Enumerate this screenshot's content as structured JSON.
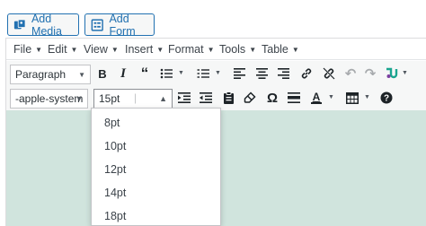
{
  "media_buttons": {
    "add_media": "Add Media",
    "add_form": "Add Form"
  },
  "menubar": {
    "items": [
      "File",
      "Edit",
      "View",
      "Insert",
      "Format",
      "Tools",
      "Table"
    ]
  },
  "toolbar1": {
    "format_select": "Paragraph"
  },
  "toolbar2": {
    "font_family_select": "-apple-system",
    "font_size_select": "15pt"
  },
  "font_size_dropdown": {
    "options": [
      "8pt",
      "10pt",
      "12pt",
      "14pt",
      "18pt"
    ]
  },
  "colors": {
    "accent": "#2271b1",
    "content_background": "#d0e4dd",
    "toolbar_background": "#f6f7f7"
  }
}
